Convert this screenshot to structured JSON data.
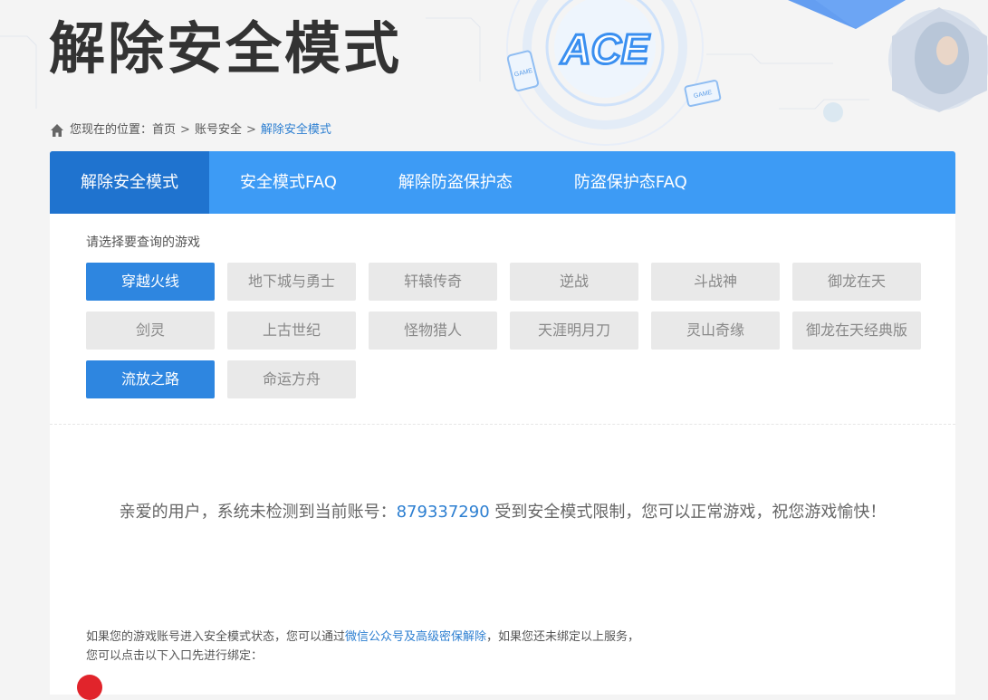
{
  "header": {
    "title": "解除安全模式",
    "logo_text": "ACE",
    "badge_game_1": "GAME",
    "badge_game_2": "GAME"
  },
  "breadcrumb": {
    "prefix": "您现在的位置：",
    "items": [
      "首页",
      "账号安全",
      "解除安全模式"
    ],
    "separator": ">"
  },
  "tabs": [
    {
      "label": "解除安全模式",
      "active": true
    },
    {
      "label": "安全模式FAQ",
      "active": false
    },
    {
      "label": "解除防盗保护态",
      "active": false
    },
    {
      "label": "防盗保护态FAQ",
      "active": false
    }
  ],
  "game_select": {
    "hint": "请选择要查询的游戏",
    "games": [
      {
        "label": "穿越火线",
        "selected": true
      },
      {
        "label": "地下城与勇士",
        "selected": false
      },
      {
        "label": "轩辕传奇",
        "selected": false
      },
      {
        "label": "逆战",
        "selected": false
      },
      {
        "label": "斗战神",
        "selected": false
      },
      {
        "label": "御龙在天",
        "selected": false
      },
      {
        "label": "剑灵",
        "selected": false
      },
      {
        "label": "上古世纪",
        "selected": false
      },
      {
        "label": "怪物猎人",
        "selected": false
      },
      {
        "label": "天涯明月刀",
        "selected": false
      },
      {
        "label": "灵山奇缘",
        "selected": false
      },
      {
        "label": "御龙在天经典版",
        "selected": false
      },
      {
        "label": "流放之路",
        "selected": true
      },
      {
        "label": "命运方舟",
        "selected": false
      }
    ]
  },
  "status": {
    "before": "亲爱的用户，系统未检测到当前账号：",
    "account": "879337290",
    "after": " 受到安全模式限制，您可以正常游戏，祝您游戏愉快！"
  },
  "note": {
    "line1_before": "如果您的游戏账号进入安全模式状态，您可以通过",
    "line1_link": "微信公众号及高级密保解除",
    "line1_after": "，如果您还未绑定以上服务，",
    "line2": "您可以点击以下入口先进行绑定："
  },
  "colors": {
    "tab_bar": "#3d9bf5",
    "tab_active": "#1f73cf",
    "game_selected": "#2e86e0",
    "link": "#2d7fd1"
  }
}
